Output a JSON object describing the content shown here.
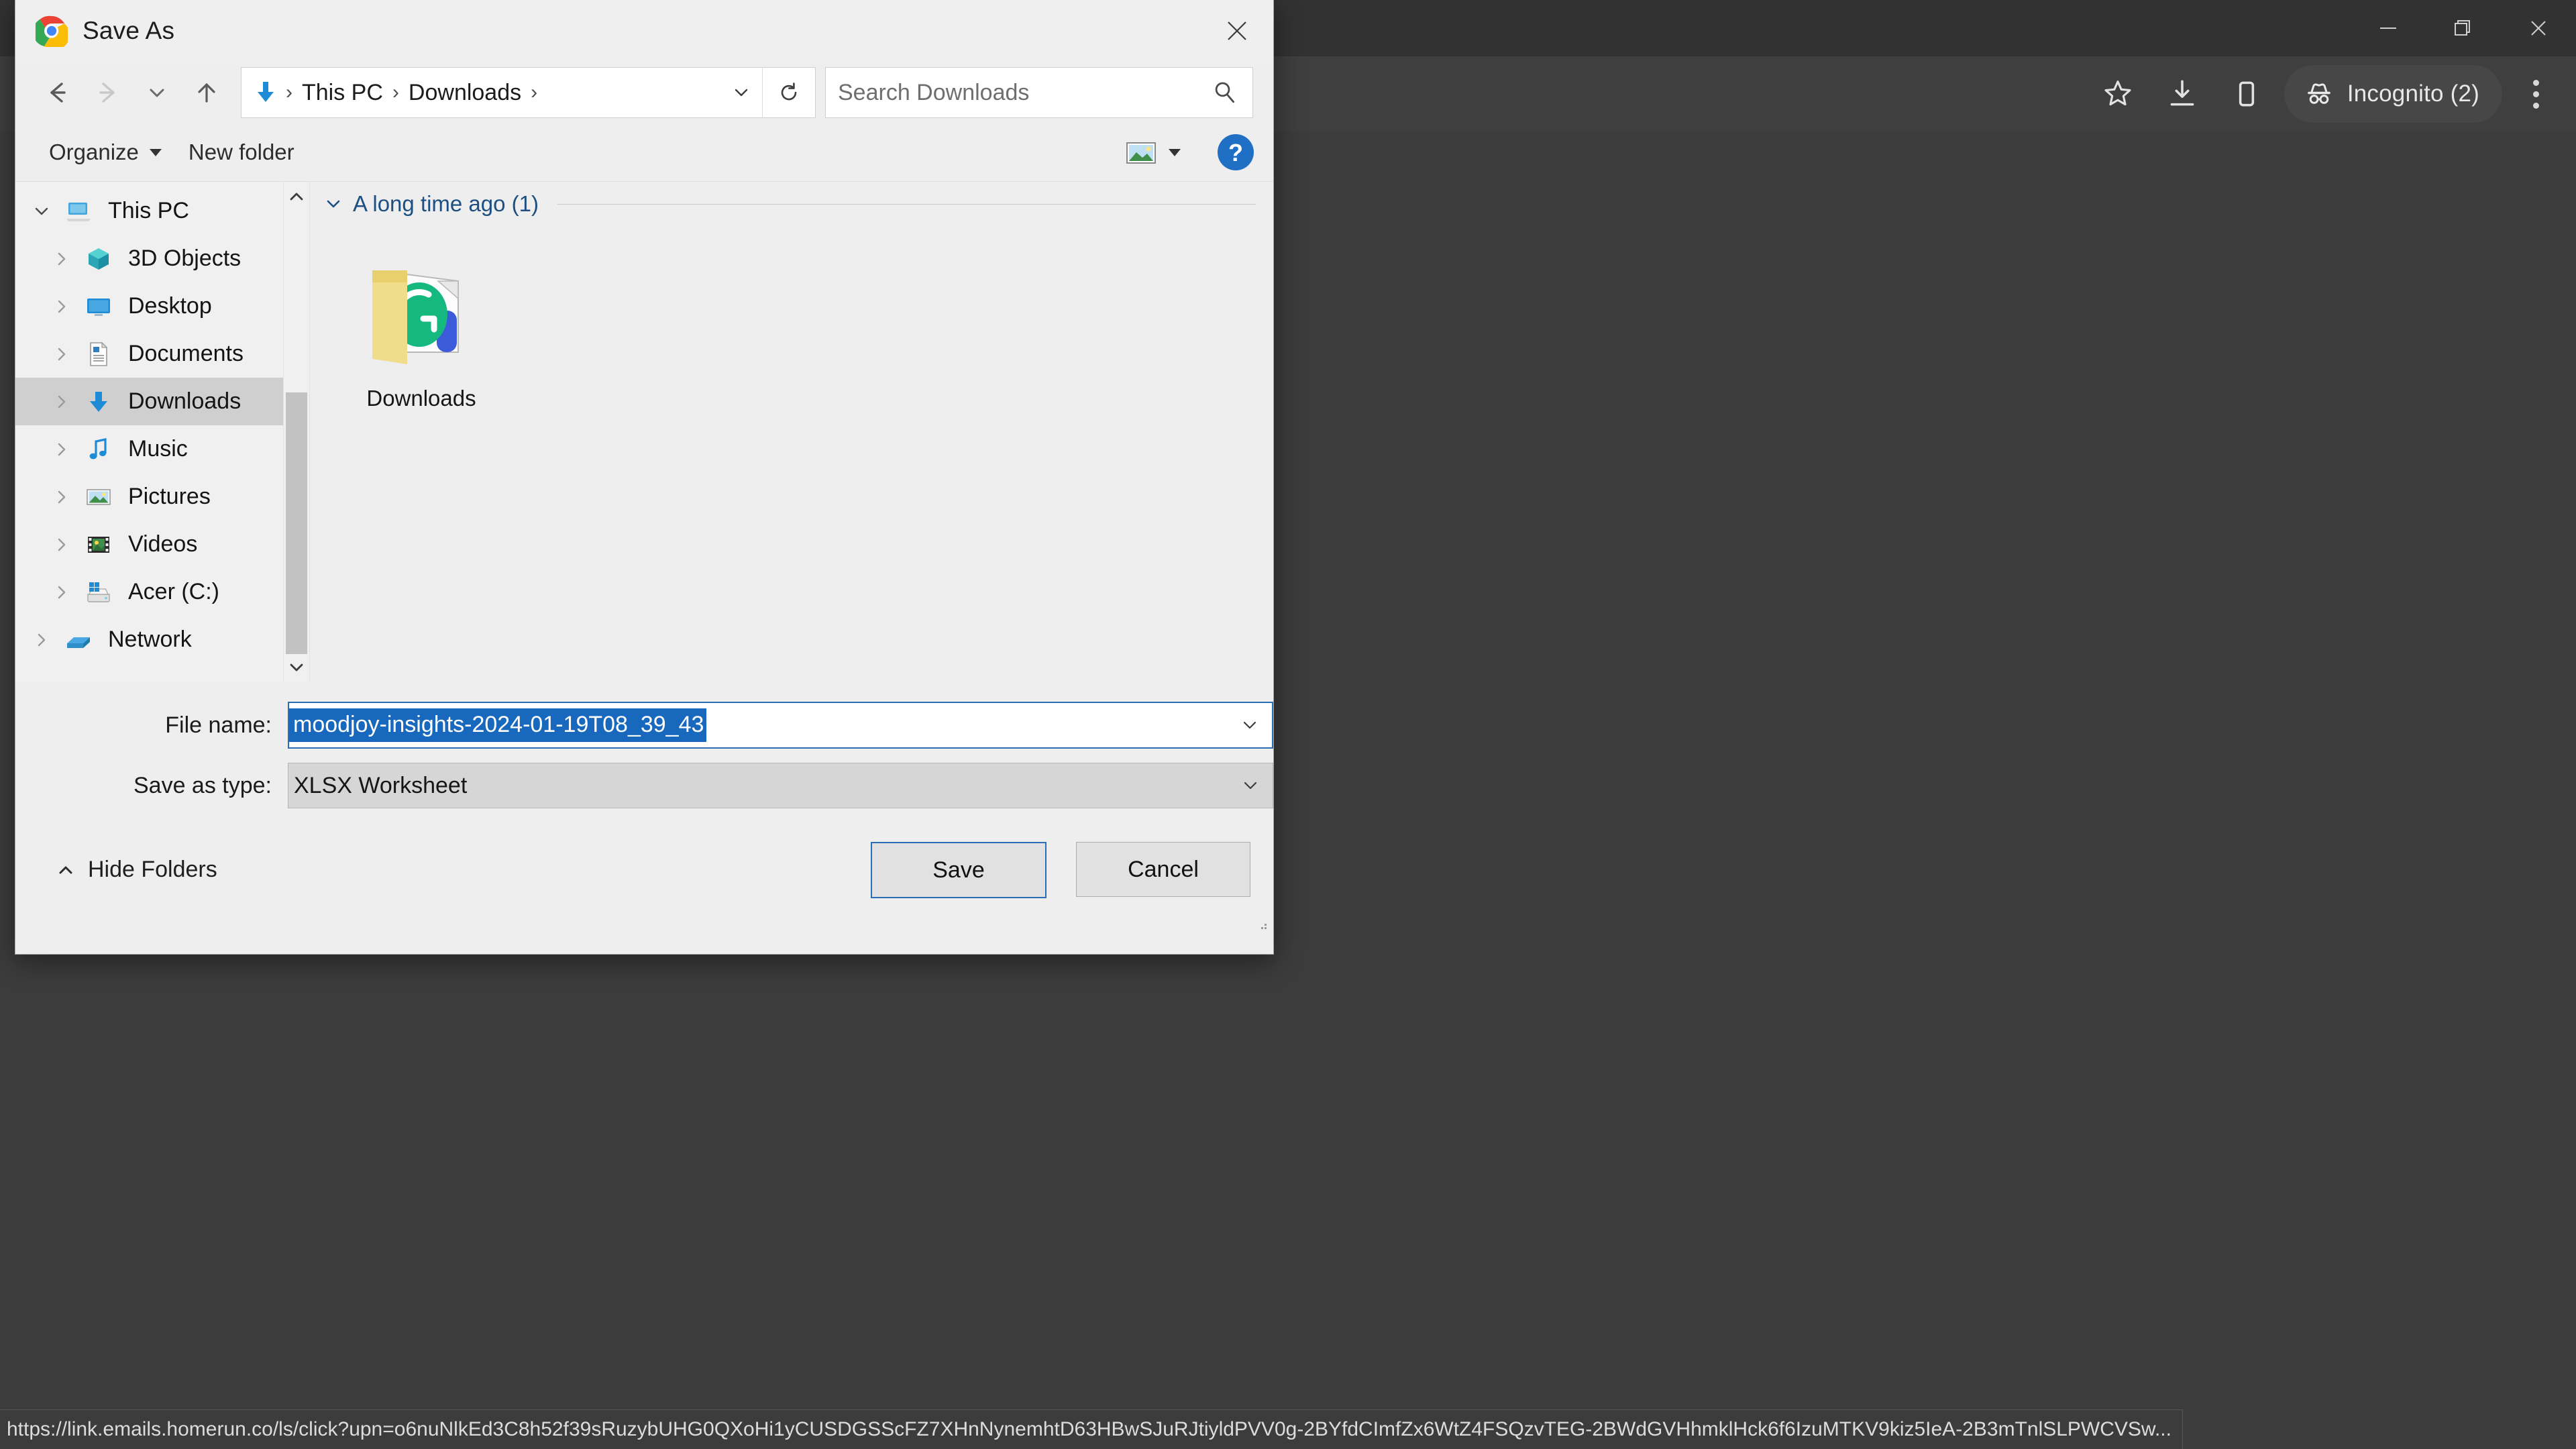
{
  "browser": {
    "window_controls": [
      {
        "name": "minimize",
        "glyph": "minimize-icon"
      },
      {
        "name": "restore",
        "glyph": "restore-icon"
      },
      {
        "name": "close",
        "glyph": "close-icon"
      }
    ],
    "toolbar": {
      "bookmark_icon": "star-icon",
      "downloads_icon": "download-icon",
      "side_panel_icon": "side-panel-icon",
      "incognito_label": "Incognito (2)",
      "incognito_icon": "incognito-hat-icon",
      "menu_icon": "three-dot-menu-icon"
    },
    "status_bar": {
      "url": "https://link.emails.homerun.co/ls/click?upn=o6nuNlkEd3C8h52f39sRuzybUHG0QXoHi1yCUSDGSScFZ7XHnNynemhtD63HBwSJuRJtiyldPVV0g-2BYfdCImfZx6WtZ4FSQzvTEG-2BWdGVHhmklHck6f6IzuMTKV9kiz5IeA-2B3mTnlSLPWCVSw..."
    }
  },
  "dialog": {
    "title": "Save As",
    "title_icon": "chrome-logo-icon",
    "close_icon": "close-icon",
    "nav": {
      "back_icon": "arrow-left-icon",
      "forward_icon": "arrow-right-icon",
      "recent_icon": "chevron-down-icon",
      "up_icon": "arrow-up-icon",
      "path_icon": "downloads-arrow-icon",
      "breadcrumbs": [
        "This PC",
        "Downloads"
      ],
      "breadcrumb_separator": "›",
      "path_dropdown_icon": "chevron-down-icon",
      "refresh_icon": "refresh-icon",
      "search_placeholder": "Search Downloads",
      "search_icon": "search-icon"
    },
    "command_bar": {
      "organize_label": "Organize",
      "organize_caret": "caret-down-icon",
      "new_folder_label": "New folder",
      "view_icon": "view-thumbnail-icon",
      "view_caret": "caret-down-icon",
      "help_label": "?",
      "help_icon": "help-icon"
    },
    "tree": {
      "items": [
        {
          "label": "This PC",
          "icon": "this-pc-icon",
          "level": 0,
          "expander": "chevron-down",
          "selected": false
        },
        {
          "label": "3D Objects",
          "icon": "3d-objects-icon",
          "level": 1,
          "expander": "chevron-right",
          "selected": false
        },
        {
          "label": "Desktop",
          "icon": "desktop-icon",
          "level": 1,
          "expander": "chevron-right",
          "selected": false
        },
        {
          "label": "Documents",
          "icon": "documents-icon",
          "level": 1,
          "expander": "chevron-right",
          "selected": false
        },
        {
          "label": "Downloads",
          "icon": "downloads-icon",
          "level": 1,
          "expander": "chevron-right",
          "selected": true
        },
        {
          "label": "Music",
          "icon": "music-icon",
          "level": 1,
          "expander": "chevron-right",
          "selected": false
        },
        {
          "label": "Pictures",
          "icon": "pictures-icon",
          "level": 1,
          "expander": "chevron-right",
          "selected": false
        },
        {
          "label": "Videos",
          "icon": "videos-icon",
          "level": 1,
          "expander": "chevron-right",
          "selected": false
        },
        {
          "label": "Acer (C:)",
          "icon": "drive-icon",
          "level": 1,
          "expander": "chevron-right",
          "selected": false
        },
        {
          "label": "Network",
          "icon": "network-icon",
          "level": 0,
          "expander": "chevron-right",
          "selected": false
        }
      ],
      "scroll_up_icon": "chevron-up-icon",
      "scroll_down_icon": "chevron-down-icon"
    },
    "file_list": {
      "group_header": "A long time ago (1)",
      "group_collapse_icon": "chevron-down-icon",
      "items": [
        {
          "label": "Downloads",
          "icon": "folder-with-grammarly-icon"
        }
      ]
    },
    "form": {
      "file_name_label": "File name:",
      "file_name_value": "moodjoy-insights-2024-01-19T08_39_43",
      "file_name_caret": "chevron-down-icon",
      "save_as_type_label": "Save as type:",
      "save_as_type_value": "XLSX Worksheet",
      "save_as_type_caret": "chevron-down-icon"
    },
    "footer": {
      "hide_folders_label": "Hide Folders",
      "hide_folders_icon": "chevron-up-icon",
      "save_label": "Save",
      "cancel_label": "Cancel"
    }
  },
  "colors": {
    "selection_blue": "#1869bd",
    "focus_blue": "#2a6fb5",
    "group_header_blue": "#1d4f82",
    "dialog_bg": "#eeeeee",
    "chrome_bg": "#3c3c3c"
  }
}
